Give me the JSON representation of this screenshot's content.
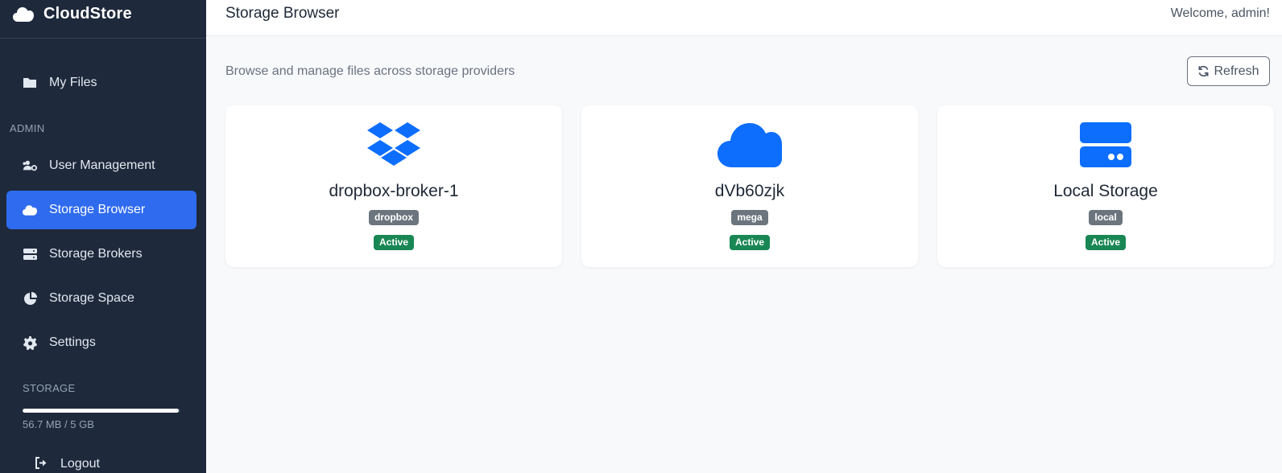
{
  "app": {
    "name": "CloudStore"
  },
  "sidebar": {
    "my_files": "My Files",
    "admin_label": "ADMIN",
    "items": [
      {
        "label": "User Management"
      },
      {
        "label": "Storage Browser"
      },
      {
        "label": "Storage Brokers"
      },
      {
        "label": "Storage Space"
      },
      {
        "label": "Settings"
      }
    ],
    "storage_label": "STORAGE",
    "storage_used": "56.7 MB / 5 GB",
    "storage_fraction": 0.99,
    "logout": "Logout"
  },
  "header": {
    "title": "Storage Browser",
    "welcome": "Welcome, admin!"
  },
  "main": {
    "subtitle": "Browse and manage files across storage providers",
    "refresh_label": "Refresh",
    "brokers": [
      {
        "name": "dropbox-broker-1",
        "type": "dropbox",
        "status": "Active",
        "icon": "dropbox-icon"
      },
      {
        "name": "dVb60zjk",
        "type": "mega",
        "status": "Active",
        "icon": "cloud-icon"
      },
      {
        "name": "Local Storage",
        "type": "local",
        "status": "Active",
        "icon": "server-icon"
      }
    ]
  },
  "colors": {
    "sidebar_bg": "#1e293b",
    "accent": "#2f6bee",
    "icon_blue": "#0d6efd",
    "badge_gray": "#6c757d",
    "badge_green": "#198754"
  }
}
